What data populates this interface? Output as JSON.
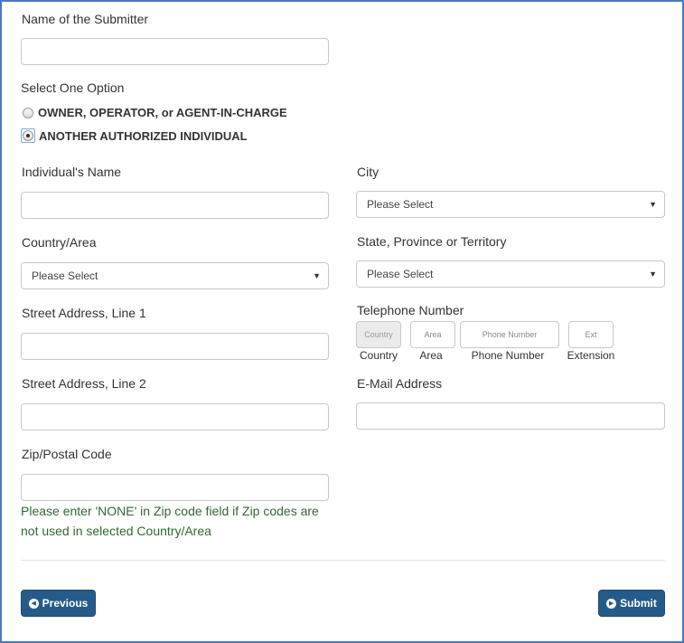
{
  "submitter": {
    "label": "Name of the Submitter",
    "value": ""
  },
  "option": {
    "label": "Select One Option",
    "choices": [
      {
        "label": "OWNER, OPERATOR, or AGENT-IN-CHARGE",
        "checked": false
      },
      {
        "label": "ANOTHER AUTHORIZED INDIVIDUAL",
        "checked": true
      }
    ]
  },
  "left": {
    "individual_name_label": "Individual's Name",
    "individual_name_value": "",
    "country_label": "Country/Area",
    "country_value": "Please Select",
    "street1_label": "Street Address, Line 1",
    "street1_value": "",
    "street2_label": "Street Address, Line 2",
    "street2_value": "",
    "zip_label": "Zip/Postal Code",
    "zip_value": "",
    "zip_hint": "Please enter 'NONE' in Zip code field if Zip codes are not used in selected Country/Area"
  },
  "right": {
    "city_label": "City",
    "city_value": "Please Select",
    "state_label": "State, Province or Territory",
    "state_value": "Please Select",
    "phone_label": "Telephone Number",
    "phone_fields": {
      "country_placeholder": "Country",
      "area_placeholder": "Area",
      "number_placeholder": "Phone Number",
      "ext_placeholder": "Ext",
      "country_caption": "Country",
      "area_caption": "Area",
      "number_caption": "Phone Number",
      "ext_caption": "Extension"
    },
    "email_label": "E-Mail Address",
    "email_value": ""
  },
  "buttons": {
    "previous_label": "Previous",
    "submit_label": "Submit"
  },
  "icons": {
    "previous": "chevron-left-circle-icon",
    "submit": "chevron-right-circle-icon",
    "dropdown": "caret-down-icon"
  },
  "colors": {
    "frame_border": "#4a78c2",
    "button_bg": "#245b88",
    "hint_text": "#2e6b2e"
  }
}
